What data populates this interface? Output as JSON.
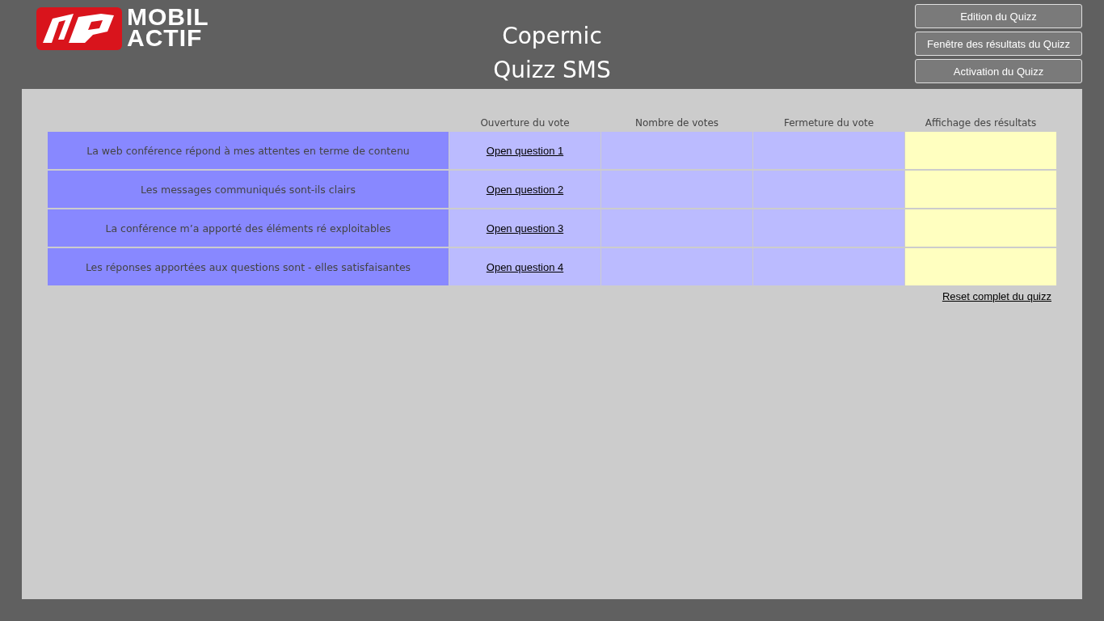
{
  "logo": {
    "line_1": "MOBIL",
    "line_2": "ACTIF"
  },
  "title": {
    "line_1": "Copernic",
    "line_2": "Quizz SMS"
  },
  "buttons": [
    "Edition du Quizz",
    "Fenêtre des résultats du Quizz",
    "Activation du Quizz"
  ],
  "table": {
    "columns": [
      "Ouverture du vote",
      "Nombre de votes",
      "Fermeture du vote",
      "Affichage des résultats"
    ],
    "rows": [
      {
        "question": "La web conférence répond à mes attentes en terme de contenu",
        "link": "Open question 1"
      },
      {
        "question": "Les messages communiqués sont-ils clairs",
        "link": "Open question 2"
      },
      {
        "question": "La conférence m’a apporté des éléments ré exploitables",
        "link": "Open question 3"
      },
      {
        "question": "Les réponses apportées aux questions sont - elles satisfaisantes",
        "link": "Open question 4"
      }
    ]
  },
  "reset_link": "Reset complet du quizz"
}
